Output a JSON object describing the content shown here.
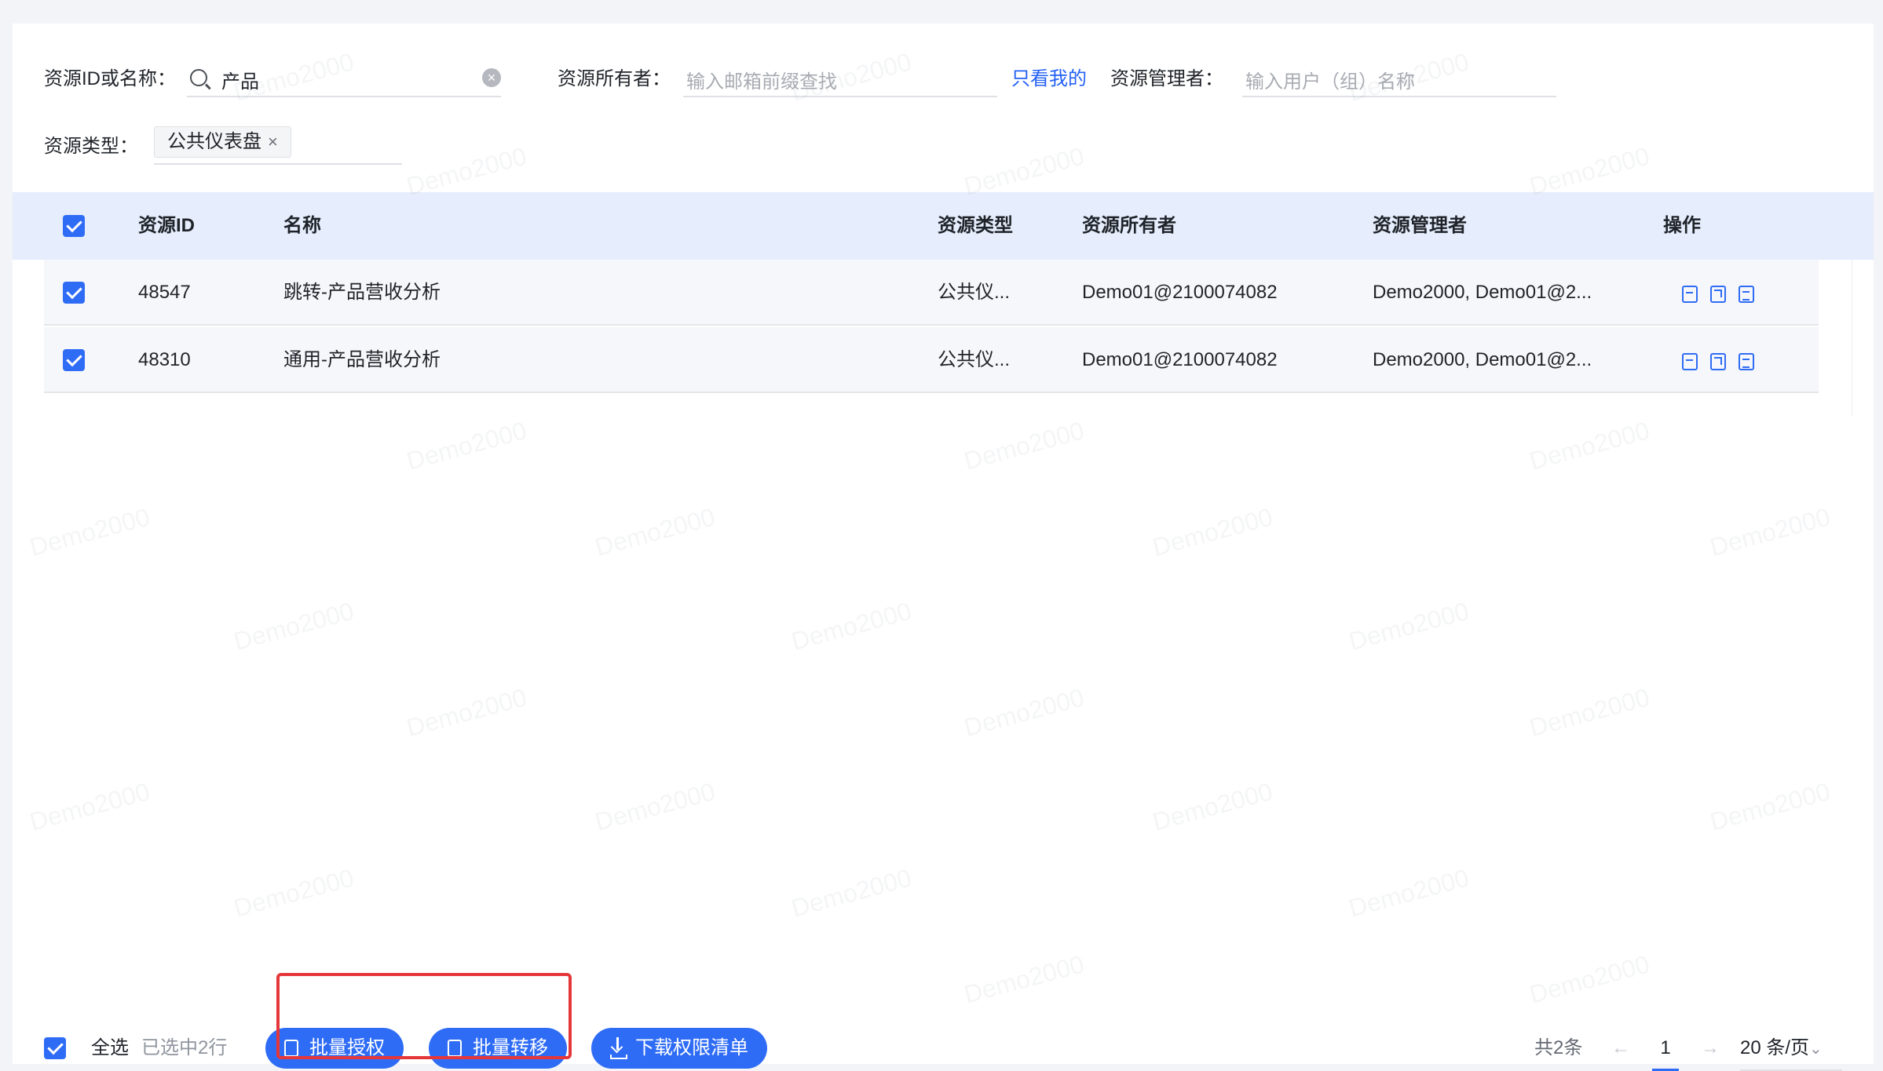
{
  "filters": {
    "resource_id_label": "资源ID或名称：",
    "resource_id_value": "产品",
    "owner_label": "资源所有者：",
    "owner_placeholder": "输入邮箱前缀查找",
    "only_mine_link": "只看我的",
    "manager_label": "资源管理者：",
    "manager_placeholder": "输入用户（组）名称",
    "type_label": "资源类型：",
    "type_tag": "公共仪表盘",
    "tag_close": "×"
  },
  "table": {
    "headers": [
      "资源ID",
      "名称",
      "资源类型",
      "资源所有者",
      "资源管理者",
      "操作"
    ],
    "rows": [
      {
        "id": "48547",
        "name": "跳转-产品营收分析",
        "type": "公共仪...",
        "owner": "Demo01@2100074082",
        "manager": "Demo2000, Demo01@2..."
      },
      {
        "id": "48310",
        "name": "通用-产品营收分析",
        "type": "公共仪...",
        "owner": "Demo01@2100074082",
        "manager": "Demo2000, Demo01@2..."
      }
    ],
    "row_actions": [
      "transfer-icon",
      "grant-icon",
      "detail-icon"
    ]
  },
  "footer": {
    "select_all_label": "全选",
    "selected_count": "已选中2行",
    "batch_grant": "批量授权",
    "batch_transfer": "批量转移",
    "download": "下载权限清单"
  },
  "pagination": {
    "total": "共2条",
    "prev": "←",
    "page": "1",
    "next": "→",
    "page_size": "20 条/页",
    "page_size_arrow": "⌄"
  },
  "watermark": "Demo2000",
  "colors": {
    "accent": "#2f6cf6",
    "header_bg": "#e6edfc",
    "highlight": "#e5373a"
  }
}
